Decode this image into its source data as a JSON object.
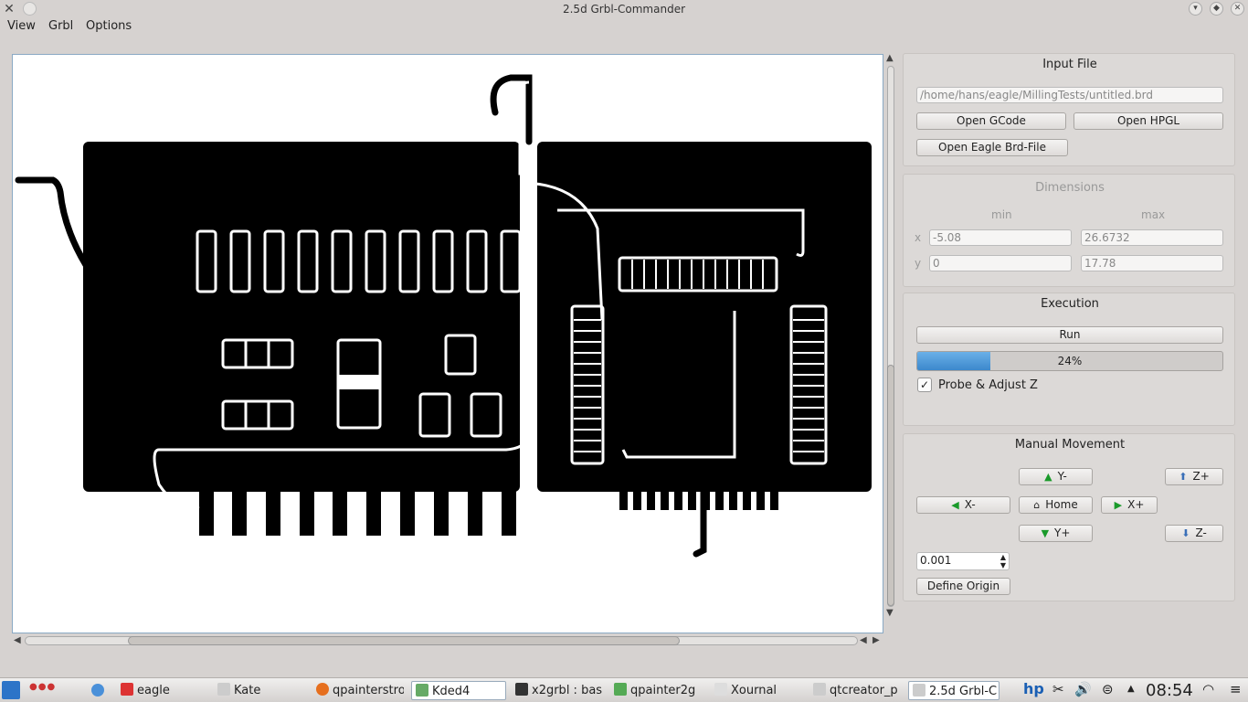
{
  "window": {
    "title": "2.5d Grbl-Commander"
  },
  "menu": [
    "View",
    "Grbl",
    "Options"
  ],
  "input_file": {
    "title": "Input File",
    "path": "/home/hans/eagle/MillingTests/untitled.brd",
    "open_gcode": "Open GCode",
    "open_hpgl": "Open HPGL",
    "open_eagle": "Open Eagle Brd-File"
  },
  "dimensions": {
    "title": "Dimensions",
    "min_label": "min",
    "max_label": "max",
    "x_label": "x",
    "y_label": "y",
    "x_min": "-5.08",
    "x_max": "26.6732",
    "y_min": "0",
    "y_max": "17.78"
  },
  "execution": {
    "title": "Execution",
    "run": "Run",
    "progress": 24,
    "progress_text": "24%",
    "probe_label": "Probe & Adjust Z",
    "probe_checked": true
  },
  "manual": {
    "title": "Manual Movement",
    "y_minus": "Y-",
    "y_plus": "Y+",
    "x_minus": "X-",
    "x_plus": "X+",
    "home": "Home",
    "z_plus": "Z+",
    "z_minus": "Z-",
    "step": "0.001",
    "define_origin": "Define Origin"
  },
  "taskbar": {
    "tasks": [
      "eagle",
      "Kate",
      "qpainterstro",
      "Kded4",
      "x2grbl : bas",
      "qpainter2g",
      "Xournal",
      "qtcreator_p",
      "2.5d Grbl-C"
    ],
    "active": "2.5d Grbl-C",
    "clock": "08:54"
  },
  "colors": {
    "accent": "#3c88cc",
    "pcb": "#000000",
    "canvas": "#ffffff"
  }
}
